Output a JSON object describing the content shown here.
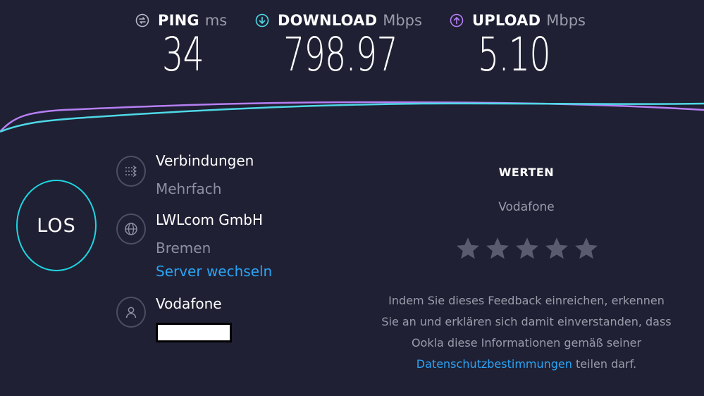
{
  "metrics": {
    "ping": {
      "label": "PING",
      "unit": "ms",
      "value": "34",
      "icon": "ping-icon"
    },
    "download": {
      "label": "DOWNLOAD",
      "unit": "Mbps",
      "value": "798.97",
      "icon": "download-arrow-icon"
    },
    "upload": {
      "label": "UPLOAD",
      "unit": "Mbps",
      "value": "5.10",
      "icon": "upload-arrow-icon"
    }
  },
  "colors": {
    "background": "#1f2033",
    "download_line": "#4fd8e6",
    "upload_line": "#b67ff4",
    "go_ring": "#1fd5e2",
    "link": "#2ba4f5",
    "muted": "#9b9caa"
  },
  "go_button": {
    "label": "LOS"
  },
  "connections": {
    "title": "Verbindungen",
    "value": "Mehrfach",
    "icon": "connections-icon"
  },
  "server": {
    "name": "LWLcom GmbH",
    "location": "Bremen",
    "change_link": "Server wechseln",
    "icon": "globe-icon"
  },
  "provider": {
    "name": "Vodafone",
    "icon": "user-icon"
  },
  "rating": {
    "title": "WERTEN",
    "provider": "Vodafone",
    "stars_filled": 0,
    "stars_total": 5,
    "disclaimer_line1": "Indem Sie dieses Feedback einreichen, erkennen",
    "disclaimer_line2": "Sie an und erklären sich damit einverstanden, dass",
    "disclaimer_line3": "Ookla diese Informationen gemäß seiner",
    "privacy_link": "Datenschutzbestimmungen",
    "disclaimer_end": " teilen darf."
  }
}
